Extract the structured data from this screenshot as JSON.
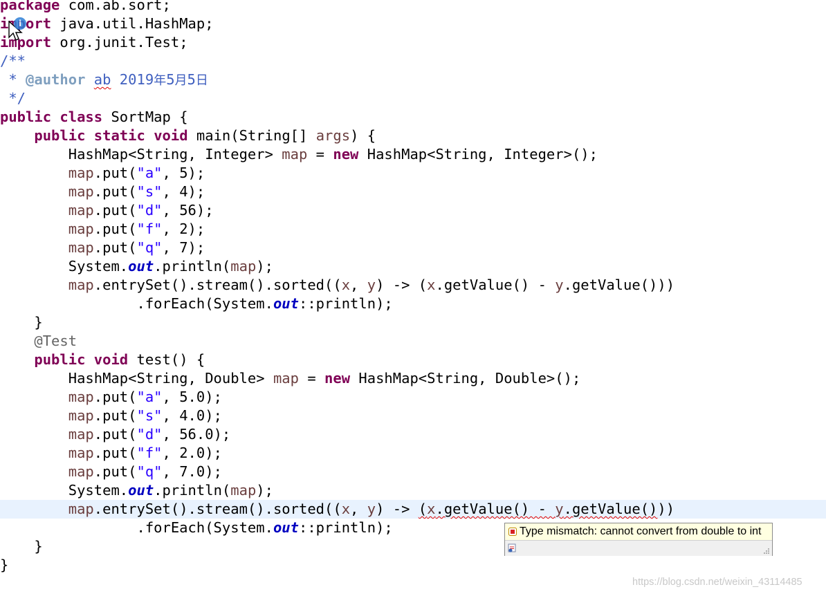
{
  "editor": {
    "code_lines": [
      [
        {
          "c": "kw",
          "t": "package"
        },
        {
          "t": " com.ab.sort;"
        }
      ],
      [
        {
          "c": "kw",
          "t": "import"
        },
        {
          "t": " java.util.HashMap;"
        }
      ],
      [
        {
          "c": "kw",
          "t": "import"
        },
        {
          "t": " org.junit.Test;"
        }
      ],
      [
        {
          "c": "cmt",
          "t": "/**"
        }
      ],
      [
        {
          "c": "cmt",
          "t": " * "
        },
        {
          "c": "tag",
          "t": "@author"
        },
        {
          "c": "cmt",
          "t": " "
        },
        {
          "c": "cmt squiggle",
          "t": "ab"
        },
        {
          "c": "cmt",
          "t": " 2019"
        },
        {
          "c": "cmt cjk",
          "t": "年"
        },
        {
          "c": "cmt",
          "t": "5"
        },
        {
          "c": "cmt cjk",
          "t": "月"
        },
        {
          "c": "cmt",
          "t": "5"
        },
        {
          "c": "cmt cjk",
          "t": "日"
        }
      ],
      [
        {
          "c": "cmt",
          "t": " */"
        }
      ],
      [
        {
          "c": "kw",
          "t": "public"
        },
        {
          "t": " "
        },
        {
          "c": "kw",
          "t": "class"
        },
        {
          "t": " SortMap {"
        }
      ],
      [
        {
          "t": "    "
        },
        {
          "c": "kw",
          "t": "public"
        },
        {
          "t": " "
        },
        {
          "c": "kw",
          "t": "static"
        },
        {
          "t": " "
        },
        {
          "c": "kw",
          "t": "void"
        },
        {
          "t": " main(String[] "
        },
        {
          "c": "fld",
          "t": "args"
        },
        {
          "t": ") {"
        }
      ],
      [
        {
          "t": "        HashMap<String, Integer> "
        },
        {
          "c": "fld",
          "t": "map"
        },
        {
          "t": " = "
        },
        {
          "c": "kw",
          "t": "new"
        },
        {
          "t": " HashMap<String, Integer>();"
        }
      ],
      [
        {
          "t": "        "
        },
        {
          "c": "fld",
          "t": "map"
        },
        {
          "t": ".put("
        },
        {
          "c": "str",
          "t": "\"a\""
        },
        {
          "t": ", 5);"
        }
      ],
      [
        {
          "t": "        "
        },
        {
          "c": "fld",
          "t": "map"
        },
        {
          "t": ".put("
        },
        {
          "c": "str",
          "t": "\"s\""
        },
        {
          "t": ", 4);"
        }
      ],
      [
        {
          "t": "        "
        },
        {
          "c": "fld",
          "t": "map"
        },
        {
          "t": ".put("
        },
        {
          "c": "str",
          "t": "\"d\""
        },
        {
          "t": ", 56);"
        }
      ],
      [
        {
          "t": "        "
        },
        {
          "c": "fld",
          "t": "map"
        },
        {
          "t": ".put("
        },
        {
          "c": "str",
          "t": "\"f\""
        },
        {
          "t": ", 2);"
        }
      ],
      [
        {
          "t": "        "
        },
        {
          "c": "fld",
          "t": "map"
        },
        {
          "t": ".put("
        },
        {
          "c": "str",
          "t": "\"q\""
        },
        {
          "t": ", 7);"
        }
      ],
      [
        {
          "t": "        System."
        },
        {
          "c": "sfld",
          "t": "out"
        },
        {
          "t": ".println("
        },
        {
          "c": "fld",
          "t": "map"
        },
        {
          "t": ");"
        }
      ],
      [
        {
          "t": "        "
        },
        {
          "c": "fld",
          "t": "map"
        },
        {
          "t": ".entrySet().stream().sorted(("
        },
        {
          "c": "fld",
          "t": "x"
        },
        {
          "t": ", "
        },
        {
          "c": "fld",
          "t": "y"
        },
        {
          "t": ") -> ("
        },
        {
          "c": "fld",
          "t": "x"
        },
        {
          "t": ".getValue() - "
        },
        {
          "c": "fld",
          "t": "y"
        },
        {
          "t": ".getValue()))"
        }
      ],
      [
        {
          "t": "                .forEach(System."
        },
        {
          "c": "sfld",
          "t": "out"
        },
        {
          "t": "::println);"
        }
      ],
      [
        {
          "t": "    }"
        }
      ],
      [
        {
          "t": "    "
        },
        {
          "c": "ann",
          "t": "@Test"
        }
      ],
      [
        {
          "t": "    "
        },
        {
          "c": "kw",
          "t": "public"
        },
        {
          "t": " "
        },
        {
          "c": "kw",
          "t": "void"
        },
        {
          "t": " test() {"
        }
      ],
      [
        {
          "t": "        HashMap<String, Double> "
        },
        {
          "c": "fld",
          "t": "map"
        },
        {
          "t": " = "
        },
        {
          "c": "kw",
          "t": "new"
        },
        {
          "t": " HashMap<String, Double>();"
        }
      ],
      [
        {
          "t": "        "
        },
        {
          "c": "fld",
          "t": "map"
        },
        {
          "t": ".put("
        },
        {
          "c": "str",
          "t": "\"a\""
        },
        {
          "t": ", 5.0);"
        }
      ],
      [
        {
          "t": "        "
        },
        {
          "c": "fld",
          "t": "map"
        },
        {
          "t": ".put("
        },
        {
          "c": "str",
          "t": "\"s\""
        },
        {
          "t": ", 4.0);"
        }
      ],
      [
        {
          "t": "        "
        },
        {
          "c": "fld",
          "t": "map"
        },
        {
          "t": ".put("
        },
        {
          "c": "str",
          "t": "\"d\""
        },
        {
          "t": ", 56.0);"
        }
      ],
      [
        {
          "t": "        "
        },
        {
          "c": "fld",
          "t": "map"
        },
        {
          "t": ".put("
        },
        {
          "c": "str",
          "t": "\"f\""
        },
        {
          "t": ", 2.0);"
        }
      ],
      [
        {
          "t": "        "
        },
        {
          "c": "fld",
          "t": "map"
        },
        {
          "t": ".put("
        },
        {
          "c": "str",
          "t": "\"q\""
        },
        {
          "t": ", 7.0);"
        }
      ],
      [
        {
          "t": "        System."
        },
        {
          "c": "sfld",
          "t": "out"
        },
        {
          "t": ".println("
        },
        {
          "c": "fld",
          "t": "map"
        },
        {
          "t": ");"
        }
      ],
      [
        {
          "t": "        "
        },
        {
          "c": "fld",
          "t": "map"
        },
        {
          "t": ".entrySet().stream().sorted(("
        },
        {
          "c": "fld",
          "t": "x"
        },
        {
          "t": ", "
        },
        {
          "c": "fld",
          "t": "y"
        },
        {
          "t": ") -> "
        },
        {
          "c": "squiggle",
          "t": "("
        },
        {
          "c": "fld squiggle",
          "t": "x"
        },
        {
          "c": "squiggle",
          "t": ".getValue() - "
        },
        {
          "c": "fld squiggle",
          "t": "y"
        },
        {
          "c": "squiggle",
          "t": ".getValue()"
        },
        {
          "t": "))"
        }
      ],
      [
        {
          "t": "                .forEach(System."
        },
        {
          "c": "sfld",
          "t": "out"
        },
        {
          "t": "::println);"
        }
      ],
      [
        {
          "t": "    }"
        }
      ],
      [
        {
          "t": "}"
        }
      ]
    ],
    "current_line_index": 27
  },
  "hover": {
    "message": "Type mismatch: cannot convert from double to int",
    "error_icon": "error-marker-icon",
    "fix_icon": "quick-fix-icon"
  },
  "cursor_badge": "i",
  "watermark": "https://blog.csdn.net/weixin_43114485",
  "colors": {
    "keyword": "#7f0055",
    "field": "#6a3e3e",
    "static_field": "#0000c0",
    "string": "#2a00ff",
    "comment": "#3f5fbf",
    "current_line": "#e8f2fe",
    "hover_bg": "#ffffe1"
  }
}
